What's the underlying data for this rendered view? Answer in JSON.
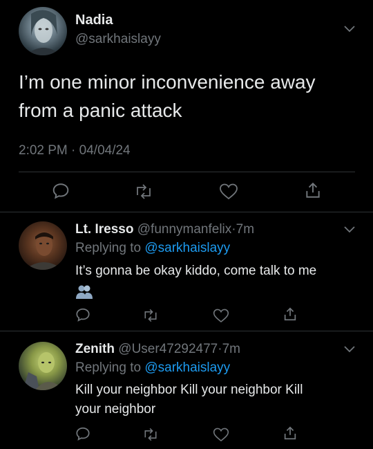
{
  "main_tweet": {
    "display_name": "Nadia",
    "handle": "@sarkhaislayy",
    "text_line1": "I’m one minor inconvenience away",
    "text_line2": "from a panic attack",
    "time": "2:02 PM",
    "separator": "·",
    "date": "04/04/24"
  },
  "replies": [
    {
      "display_name": "Lt. Iresso",
      "handle": "@funnymanfelix",
      "separator": "·",
      "age": "7m",
      "replying_prefix": "Replying to",
      "replying_handle": "@sarkhaislayy",
      "text": "It’s gonna be okay kiddo, come talk to me",
      "emoji_icon": "busts-in-silhouette-icon"
    },
    {
      "display_name": "Zenith",
      "handle": "@User47292477",
      "separator": "·",
      "age": "7m",
      "replying_prefix": "Replying to",
      "replying_handle": "@sarkhaislayy",
      "text_line1": "Kill your neighbor Kill your neighbor Kill",
      "text_line2": "your neighbor"
    }
  ],
  "colors": {
    "background": "#000000",
    "text": "#e7e9ea",
    "muted": "#71767b",
    "link": "#1d9bf0",
    "divider": "#2f3336"
  }
}
